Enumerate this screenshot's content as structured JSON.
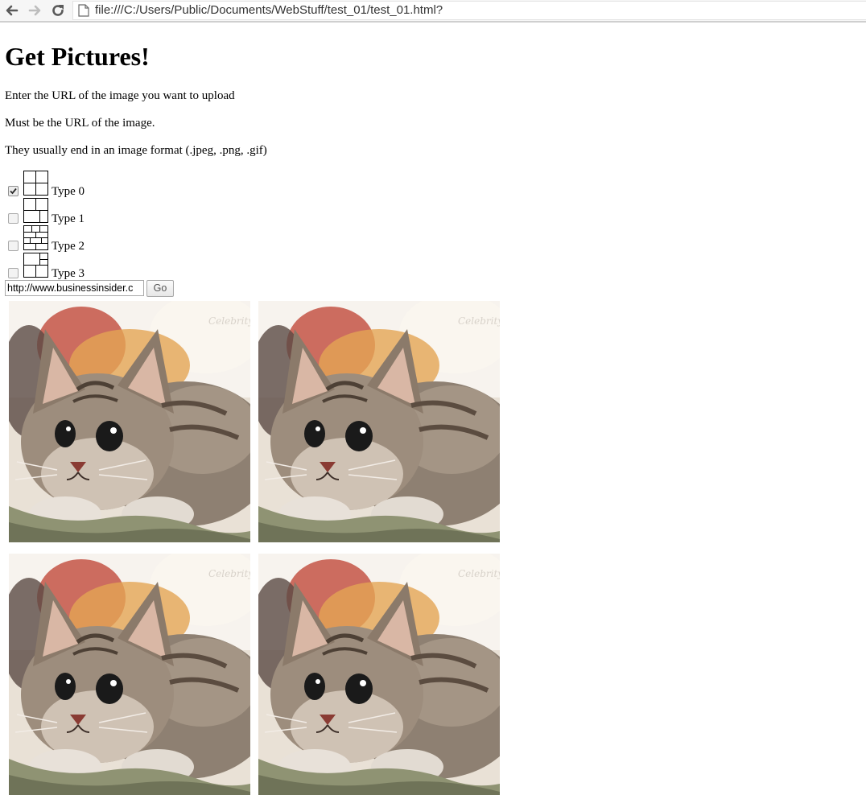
{
  "browser": {
    "url": "file:///C:/Users/Public/Documents/WebStuff/test_01/test_01.html?"
  },
  "page": {
    "title": "Get Pictures!",
    "instructions": [
      "Enter the URL of the image you want to upload",
      "Must be the URL of the image.",
      "They usually end in an image format (.jpeg, .png, .gif)"
    ],
    "layout_options": [
      {
        "label": "Type 0",
        "checked": true
      },
      {
        "label": "Type 1",
        "checked": false
      },
      {
        "label": "Type 2",
        "checked": false
      },
      {
        "label": "Type 3",
        "checked": false
      }
    ],
    "url_input_value": "http://www.businessinsider.c",
    "go_label": "Go",
    "images": [
      {
        "subject": "kitten",
        "watermark": "Celebrity"
      },
      {
        "subject": "kitten",
        "watermark": "Celebrity"
      },
      {
        "subject": "kitten",
        "watermark": "Celebrity"
      },
      {
        "subject": "kitten",
        "watermark": "Celebrity"
      }
    ]
  },
  "colors": {
    "toolbar_bg": "#f6f6f6",
    "icon_gray": "#5a5a5a",
    "icon_disabled": "#bdbdbd"
  }
}
